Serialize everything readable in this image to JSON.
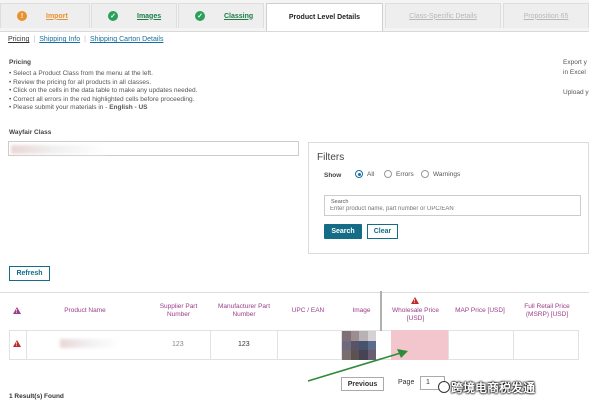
{
  "tabs": [
    {
      "label": "Import",
      "status": "warning",
      "badge": "!",
      "badge_color": "#e8912d",
      "label_color": "#e8912d"
    },
    {
      "label": "Images",
      "status": "done",
      "badge": "✓",
      "badge_color": "#2aa05a",
      "label_color": "#1c7c45"
    },
    {
      "label": "Classing",
      "status": "done",
      "badge": "✓",
      "badge_color": "#2aa05a",
      "label_color": "#1c7c45"
    },
    {
      "label": "Product Level Details",
      "status": "active"
    },
    {
      "label": "Class-Specific Details",
      "status": "disabled"
    },
    {
      "label": "Proposition 65",
      "status": "disabled"
    }
  ],
  "sublinks": [
    {
      "label": "Pricing",
      "active": true
    },
    {
      "label": "Shipping Info",
      "active": false
    },
    {
      "label": "Shipping Carton Details",
      "active": false
    }
  ],
  "pricing": {
    "heading": "Pricing",
    "instructions": [
      "• Select a Product Class from the menu at the left.",
      "• Review the pricing for all products in all classes.",
      "• Click on the cells in the data table to make any updates needed.",
      "• Correct all errors in the red highlighted cells before proceeding."
    ],
    "language_prefix": "• Please submit your materials in - ",
    "language": "English - US"
  },
  "right_notes": {
    "line1": "Export y",
    "line2": "in Excel",
    "line3": "Upload y"
  },
  "wayfair_class": {
    "label": "Wayfair Class"
  },
  "filters": {
    "title": "Filters",
    "show_label": "Show",
    "options": [
      {
        "label": "All",
        "selected": true
      },
      {
        "label": "Errors",
        "selected": false
      },
      {
        "label": "Warnings",
        "selected": false
      }
    ],
    "search_label": "Search",
    "search_placeholder": "Enter product name, part number or UPC/EAN",
    "search_button": "Search",
    "clear_button": "Clear"
  },
  "refresh_button": "Refresh",
  "table": {
    "headers": {
      "product_name": "Product Name",
      "supplier_part_1": "Supplier Part",
      "supplier_part_2": "Number",
      "manufacturer_part_1": "Manufacturer Part",
      "manufacturer_part_2": "Number",
      "upc": "UPC / EAN",
      "image": "Image",
      "wholesale_1": "Wholesale Price",
      "wholesale_2": "[USD]",
      "map": "MAP Price [USD]",
      "retail_1": "Full Retail Price",
      "retail_2": "(MSRP) [USD]"
    },
    "rows": [
      {
        "supplier_part": "123",
        "manufacturer_part": "123"
      }
    ]
  },
  "pager": {
    "previous": "Previous",
    "page_label": "Page",
    "page_value": "1"
  },
  "results": "1 Result(s) Found",
  "watermark": "跨境电商税发通",
  "colors": {
    "accent": "#146c86",
    "error": "#c0282b",
    "error_fill": "#f2c6cc",
    "header_text": "#9a3d8a",
    "arrow": "#2e8b3a"
  }
}
